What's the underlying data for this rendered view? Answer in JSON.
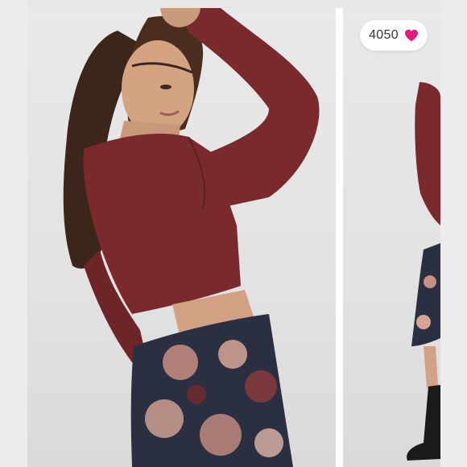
{
  "listing": {
    "like_count": "4050"
  },
  "icons": {
    "like": "heart-icon"
  },
  "colors": {
    "heart": "#e6197a",
    "sweater": "#7a2a2c",
    "skirt": "#2a3042"
  }
}
